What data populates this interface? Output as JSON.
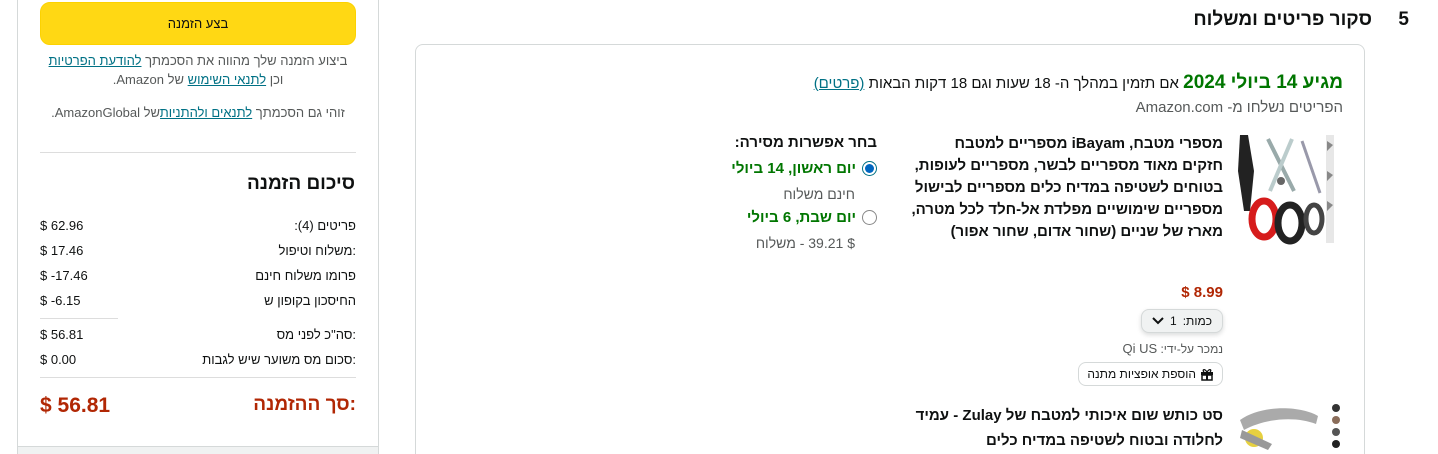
{
  "summary": {
    "place_order": "בצע הזמנה",
    "legal1_pre": "ביצוע הזמנה שלך מהווה את הסכמתך ",
    "legal1_link1": "להודעת הפרטיות",
    "legal1_mid": " וכן ",
    "legal1_link2": "לתנאי השימוש",
    "legal1_post": " של Amazon.",
    "legal2_pre": "זוהי גם הסכמתך ",
    "legal2_link": "לתנאים ולהתניות",
    "legal2_post": "של AmazonGlobal.",
    "title": "סיכום הזמנה",
    "rows": [
      {
        "label": "פריטים (4):",
        "value": "$ 62.96"
      },
      {
        "label": ":משלוח וטיפול",
        "value": "$ 17.46"
      },
      {
        "label": "פרומו משלוח חינם",
        "value": "$ -17.46"
      },
      {
        "label": "החיסכון בקופון ש",
        "value": "$ -6.15"
      },
      {
        "label": ":סה\"כ לפני מס",
        "value": "$ 56.81"
      },
      {
        "label": ":סכום מס משוער שיש לגבות",
        "value": "$ 0.00"
      }
    ],
    "total_label": ":סך ההזמנה",
    "total_value": "$ 56.81"
  },
  "step": {
    "number": "5",
    "title": "סקור פריטים ומשלוח"
  },
  "delivery": {
    "arrive_label": "מגיע 14 ביולי 2024",
    "countdown": " אם תזמין במהלך ה-  18  שעות וגם 18 דקות הבאות ",
    "details_link": "(פרטים)",
    "shipped_from": "הפריטים נשלחו מ- Amazon.com"
  },
  "product1": {
    "title": "מספרי מטבח, iBayam מספריים למטבח חזקים מאוד מספריים לבשר, מספריים לעופות, בטוחים לשטיפה במדיח כלים מספריים לבישול מספריים שימושיים מפלדת אל-חלד לכל מטרה, מארז של שניים (שחור אדום, שחור אפור)",
    "price": "$ 8.99",
    "qty_label": "כמות:",
    "qty_value": "1",
    "sold_by_label": "נמכר על-ידי: ",
    "sold_by": "Qi US",
    "gift_label": "הוספת אופציות מתנה"
  },
  "shipping": {
    "header": "בחר אפשרות מסירה:",
    "option1": "יום ראשון, 14 ביולי",
    "option1_sub": "חינם משלוח",
    "option2": "יום שבת, 6 ביולי",
    "option2_sub": "$ 39.21 - משלוח"
  },
  "product2": {
    "title": "סט כותש שום איכותי למטבח של Zulay - עמיד לחלודה ובטוח לשטיפה במדיח כלים"
  },
  "colors": {
    "accent_yellow": "#ffd814",
    "green": "#007600",
    "price_red": "#b12704",
    "link": "#007185"
  }
}
